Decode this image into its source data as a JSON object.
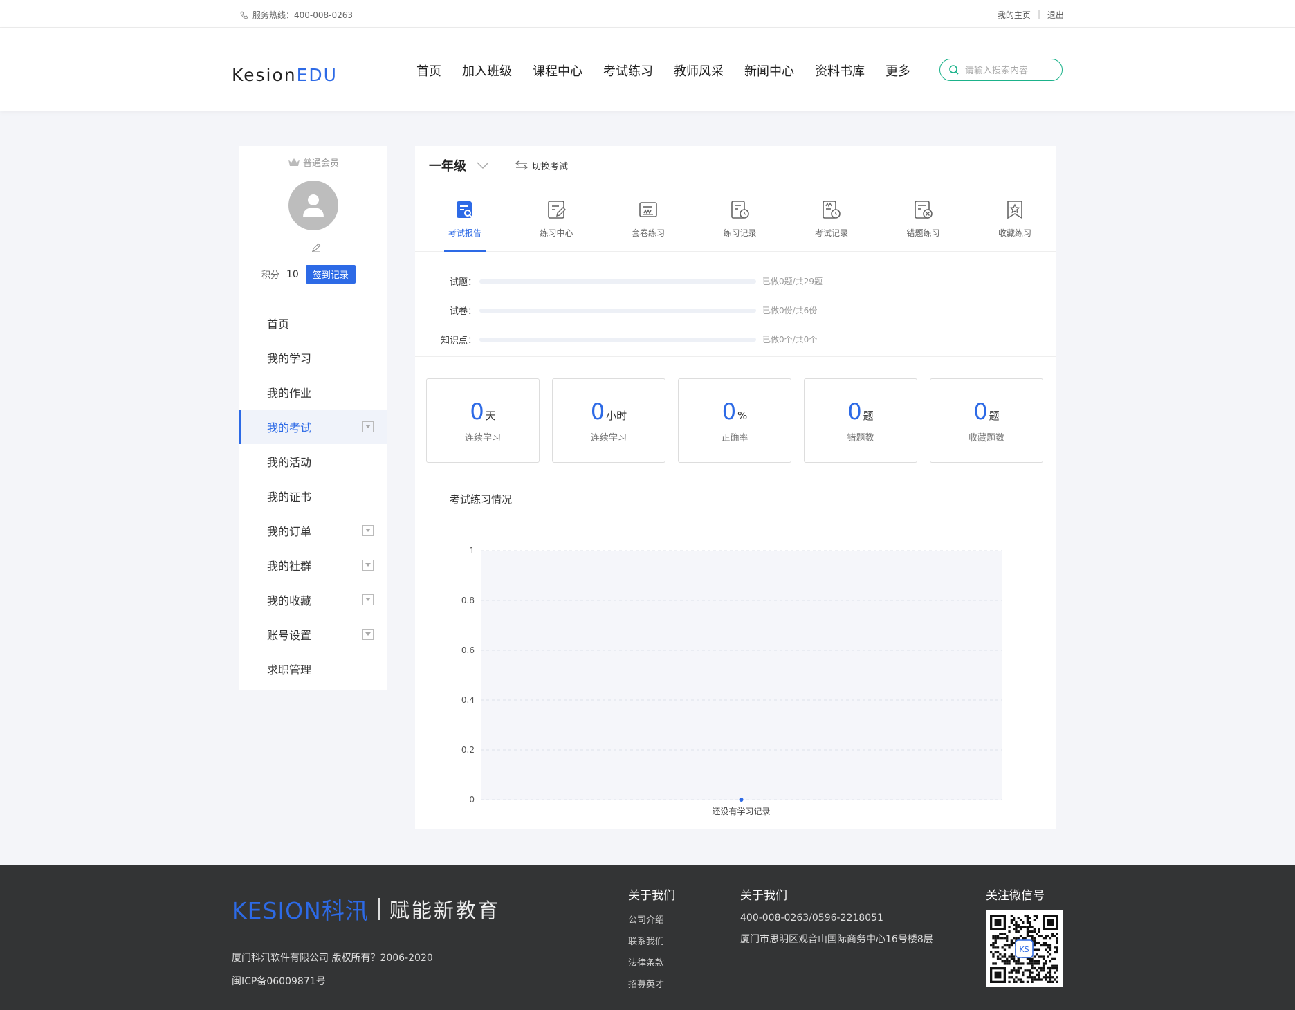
{
  "topbar": {
    "hotline": "服务热线：400-008-0263",
    "my_home": "我的主页",
    "separator": "|",
    "logout": "退出"
  },
  "header": {
    "logo_main": "Kesion",
    "logo_accent": "EDU",
    "nav": [
      "首页",
      "加入班级",
      "课程中心",
      "考试练习",
      "教师风采",
      "新闻中心",
      "资料书库",
      "更多"
    ],
    "search_placeholder": "请输入搜索内容"
  },
  "sidebar": {
    "member_level": "普通会员",
    "points_label": "积分",
    "points_value": "10",
    "sign_button": "签到记录",
    "menu": [
      {
        "label": "首页",
        "has_arrow": false
      },
      {
        "label": "我的学习",
        "has_arrow": false
      },
      {
        "label": "我的作业",
        "has_arrow": false
      },
      {
        "label": "我的考试",
        "has_arrow": true,
        "active": true
      },
      {
        "label": "我的活动",
        "has_arrow": false
      },
      {
        "label": "我的证书",
        "has_arrow": false
      },
      {
        "label": "我的订单",
        "has_arrow": true
      },
      {
        "label": "我的社群",
        "has_arrow": true
      },
      {
        "label": "我的收藏",
        "has_arrow": true
      },
      {
        "label": "账号设置",
        "has_arrow": true
      },
      {
        "label": "求职管理",
        "has_arrow": false
      }
    ]
  },
  "main": {
    "grade": "一年级",
    "switch_exam": "切换考试",
    "tabs": [
      {
        "label": "考试报告",
        "icon": "report-search-icon",
        "active": true
      },
      {
        "label": "练习中心",
        "icon": "edit-doc-icon"
      },
      {
        "label": "套卷练习",
        "icon": "paper-set-icon"
      },
      {
        "label": "练习记录",
        "icon": "doc-clock-icon"
      },
      {
        "label": "考试记录",
        "icon": "exam-clock-icon"
      },
      {
        "label": "错题练习",
        "icon": "doc-x-icon"
      },
      {
        "label": "收藏练习",
        "icon": "bookmark-star-icon"
      }
    ],
    "progress": [
      {
        "label": "试题：",
        "info": "已做0题/共29题",
        "fraction": 0
      },
      {
        "label": "试卷：",
        "info": "已做0份/共6份",
        "fraction": 0
      },
      {
        "label": "知识点：",
        "info": "已做0个/共0个",
        "fraction": 0
      }
    ],
    "stats": [
      {
        "value": "0",
        "unit": "天",
        "label": "连续学习"
      },
      {
        "value": "0",
        "unit": "小时",
        "label": "连续学习"
      },
      {
        "value": "0",
        "unit": "%",
        "label": "正确率"
      },
      {
        "value": "0",
        "unit": "题",
        "label": "错题数"
      },
      {
        "value": "0",
        "unit": "题",
        "label": "收藏题数"
      }
    ],
    "chart_title": "考试练习情况"
  },
  "chart_data": {
    "type": "line",
    "title": "考试练习情况",
    "categories": [
      "还没有学习记录"
    ],
    "values": [
      0
    ],
    "yticks": [
      "0",
      "0.2",
      "0.4",
      "0.6",
      "0.8",
      "1"
    ],
    "ylim": [
      0,
      1
    ],
    "grid": true,
    "accent": "#2d6ae6"
  },
  "footer": {
    "brand": "KESION科汛",
    "slogan": "赋能新教育",
    "copyright": "厦门科汛软件有限公司 版权所有？2006-2020",
    "icp": "闽ICP备06009871号",
    "col1_title": "关于我们",
    "col1_links": [
      "公司介绍",
      "联系我们",
      "法律条款",
      "招募英才"
    ],
    "col2_title": "关于我们",
    "col2_phone": "400-008-0263/0596-2218051",
    "col2_address": "厦门市思明区观音山国际商务中心16号楼8层",
    "wechat_title": "关注微信号",
    "qr_label": "KS"
  },
  "colors": {
    "accent": "#2d6ae6",
    "search_border": "#1bb28a",
    "footer_bg": "#333435"
  }
}
